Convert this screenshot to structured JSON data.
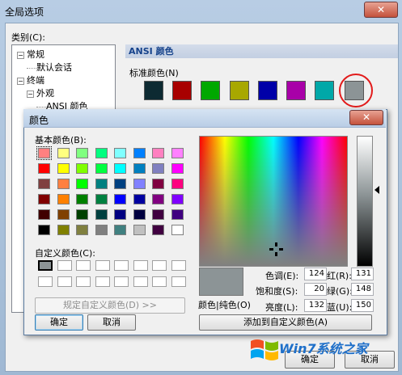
{
  "main_dialog": {
    "title": "全局选项",
    "close_glyph": "✕",
    "category_label": "类别(C):",
    "tree": [
      {
        "label": "常规",
        "indent": 0,
        "expander": "−"
      },
      {
        "label": "默认会话",
        "indent": 1,
        "expander": ""
      },
      {
        "label": "终端",
        "indent": 0,
        "expander": "−"
      },
      {
        "label": "外观",
        "indent": 1,
        "expander": "−"
      },
      {
        "label": "ANSI 颜色",
        "indent": 2,
        "expander": ""
      }
    ],
    "section_header": "ANSI 颜色",
    "standard_colors_label": "标准颜色(N)",
    "ansi_colors": [
      "#0d2a32",
      "#a80000",
      "#00a800",
      "#a8a800",
      "#0000a8",
      "#a800a8",
      "#00a8a8",
      "#8c9496"
    ],
    "ok_label": "确定",
    "cancel_label": "取消"
  },
  "color_dialog": {
    "title": "颜色",
    "close_glyph": "✕",
    "basic_colors_label": "基本颜色(B):",
    "basic_colors": [
      [
        "#ff8080",
        "#ffff80",
        "#80ff80",
        "#00ff80",
        "#80ffff",
        "#0080ff",
        "#ff80c0",
        "#ff80ff"
      ],
      [
        "#ff0000",
        "#ffff00",
        "#80ff00",
        "#00ff40",
        "#00ffff",
        "#0080c0",
        "#8080c0",
        "#ff00ff"
      ],
      [
        "#804040",
        "#ff8040",
        "#00ff00",
        "#008080",
        "#004080",
        "#8080ff",
        "#800040",
        "#ff0080"
      ],
      [
        "#800000",
        "#ff8000",
        "#008000",
        "#008040",
        "#0000ff",
        "#0000a0",
        "#800080",
        "#8000ff"
      ],
      [
        "#400000",
        "#804000",
        "#004000",
        "#004040",
        "#000080",
        "#000040",
        "#400040",
        "#400080"
      ],
      [
        "#000000",
        "#808000",
        "#808040",
        "#808080",
        "#408080",
        "#c0c0c0",
        "#400040",
        "#ffffff"
      ]
    ],
    "custom_colors_label": "自定义颜色(C):",
    "custom_colors": [
      [
        "#8c9496",
        "#ffffff",
        "#ffffff",
        "#ffffff",
        "#ffffff",
        "#ffffff",
        "#ffffff",
        "#ffffff"
      ],
      [
        "#ffffff",
        "#ffffff",
        "#ffffff",
        "#ffffff",
        "#ffffff",
        "#ffffff",
        "#ffffff",
        "#ffffff"
      ]
    ],
    "define_custom_label": "规定自定义颜色(D) >>",
    "ok_label": "确定",
    "cancel_label": "取消",
    "preview_label": "颜色|纯色(O)",
    "hue_label": "色调(E):",
    "hue": "124",
    "sat_label": "饱和度(S):",
    "sat": "20",
    "lum_label": "亮度(L):",
    "lum": "132",
    "red_label": "红(R):",
    "red": "131",
    "green_label": "绿(G):",
    "green": "148",
    "blue_label": "蓝(U):",
    "blue": "150",
    "add_custom_label": "添加到自定义颜色(A)",
    "preview_color": "#8c9496"
  },
  "watermark": {
    "brand": "Win7系统之家",
    "icon": "windows-logo-icon"
  }
}
